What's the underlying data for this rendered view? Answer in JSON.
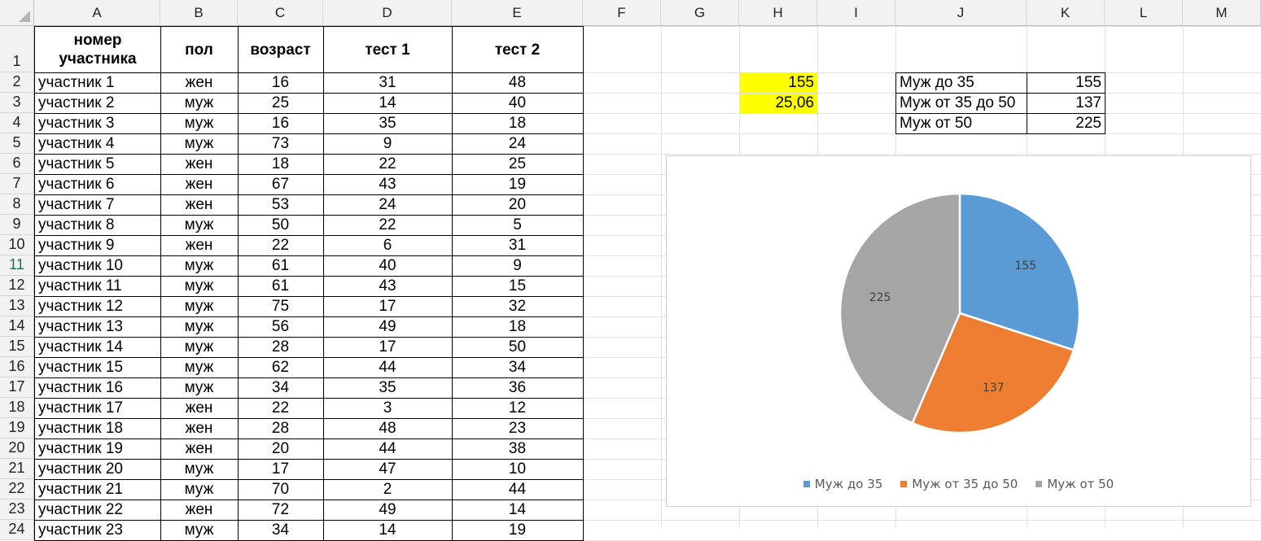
{
  "columns": [
    "A",
    "B",
    "C",
    "D",
    "E",
    "F",
    "G",
    "H",
    "I",
    "J",
    "K",
    "L",
    "M"
  ],
  "rows": [
    "1",
    "2",
    "3",
    "4",
    "5",
    "6",
    "7",
    "8",
    "9",
    "10",
    "11",
    "12",
    "13",
    "14",
    "15",
    "16",
    "17",
    "18",
    "19",
    "20",
    "21",
    "22",
    "23",
    "24"
  ],
  "selected_row": "11",
  "table": {
    "headers": [
      "номер участника",
      "пол",
      "возраст",
      "тест 1",
      "тест 2"
    ],
    "records": [
      [
        "участник 1",
        "жен",
        "16",
        "31",
        "48"
      ],
      [
        "участник 2",
        "муж",
        "25",
        "14",
        "40"
      ],
      [
        "участник 3",
        "муж",
        "16",
        "35",
        "18"
      ],
      [
        "участник 4",
        "муж",
        "73",
        "9",
        "24"
      ],
      [
        "участник 5",
        "жен",
        "18",
        "22",
        "25"
      ],
      [
        "участник 6",
        "жен",
        "67",
        "43",
        "19"
      ],
      [
        "участник 7",
        "жен",
        "53",
        "24",
        "20"
      ],
      [
        "участник 8",
        "муж",
        "50",
        "22",
        "5"
      ],
      [
        "участник 9",
        "жен",
        "22",
        "6",
        "31"
      ],
      [
        "участник 10",
        "муж",
        "61",
        "40",
        "9"
      ],
      [
        "участник 11",
        "муж",
        "61",
        "43",
        "15"
      ],
      [
        "участник 12",
        "муж",
        "75",
        "17",
        "32"
      ],
      [
        "участник 13",
        "муж",
        "56",
        "49",
        "18"
      ],
      [
        "участник 14",
        "муж",
        "28",
        "17",
        "50"
      ],
      [
        "участник 15",
        "муж",
        "62",
        "44",
        "34"
      ],
      [
        "участник 16",
        "муж",
        "34",
        "35",
        "36"
      ],
      [
        "участник 17",
        "жен",
        "22",
        "3",
        "12"
      ],
      [
        "участник 18",
        "жен",
        "28",
        "48",
        "23"
      ],
      [
        "участник 19",
        "жен",
        "20",
        "44",
        "38"
      ],
      [
        "участник 20",
        "муж",
        "17",
        "47",
        "10"
      ],
      [
        "участник 21",
        "муж",
        "70",
        "2",
        "44"
      ],
      [
        "участник 22",
        "жен",
        "72",
        "49",
        "14"
      ],
      [
        "участник 23",
        "муж",
        "34",
        "14",
        "19"
      ]
    ]
  },
  "highlight": {
    "h2": "155",
    "h3": "25,06",
    "color": "#ffff00"
  },
  "summary": [
    {
      "label": "Муж до 35",
      "value": "155"
    },
    {
      "label": "Муж от 35 до 50",
      "value": "137"
    },
    {
      "label": "Муж от 50",
      "value": "225"
    }
  ],
  "chart_data": {
    "type": "pie",
    "categories": [
      "Муж до 35",
      "Муж от 35 до 50",
      "Муж от 50"
    ],
    "values": [
      155,
      137,
      225
    ],
    "colors": [
      "#5b9bd5",
      "#ed7d31",
      "#a5a5a5"
    ],
    "data_labels": [
      "155",
      "137",
      "225"
    ],
    "legend": "bottom",
    "title": ""
  }
}
